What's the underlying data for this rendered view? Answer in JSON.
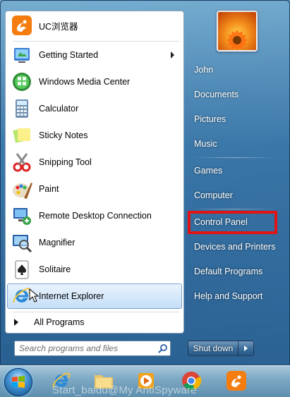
{
  "start_menu": {
    "pinned_app": {
      "label": "UC浏览器",
      "icon": "uc-browser-icon"
    },
    "apps": [
      {
        "label": "Getting Started",
        "icon": "getting-started-icon",
        "has_submenu": true
      },
      {
        "label": "Windows Media Center",
        "icon": "media-center-icon"
      },
      {
        "label": "Calculator",
        "icon": "calculator-icon"
      },
      {
        "label": "Sticky Notes",
        "icon": "sticky-notes-icon"
      },
      {
        "label": "Snipping Tool",
        "icon": "snipping-tool-icon"
      },
      {
        "label": "Paint",
        "icon": "paint-icon"
      },
      {
        "label": "Remote Desktop Connection",
        "icon": "remote-desktop-icon"
      },
      {
        "label": "Magnifier",
        "icon": "magnifier-icon"
      },
      {
        "label": "Solitaire",
        "icon": "solitaire-icon"
      },
      {
        "label": "Internet Explorer",
        "icon": "internet-explorer-icon",
        "selected": true
      }
    ],
    "all_programs_label": "All Programs",
    "search_placeholder": "Search programs and files",
    "right_items": [
      {
        "label": "John"
      },
      {
        "label": "Documents"
      },
      {
        "label": "Pictures"
      },
      {
        "label": "Music"
      },
      {
        "label": "Games"
      },
      {
        "label": "Computer"
      },
      {
        "label": "Control Panel",
        "highlighted": true
      },
      {
        "label": "Devices and Printers"
      },
      {
        "label": "Default Programs"
      },
      {
        "label": "Help and Support"
      }
    ],
    "shutdown_label": "Shut down",
    "highlight_color": "#e01414"
  },
  "taskbar": {
    "items": [
      "start-orb-icon",
      "internet-explorer-icon",
      "folder-icon",
      "media-player-icon",
      "chrome-icon",
      "uc-browser-icon"
    ],
    "watermark": "Start_baidu@My AntiSpyware"
  }
}
